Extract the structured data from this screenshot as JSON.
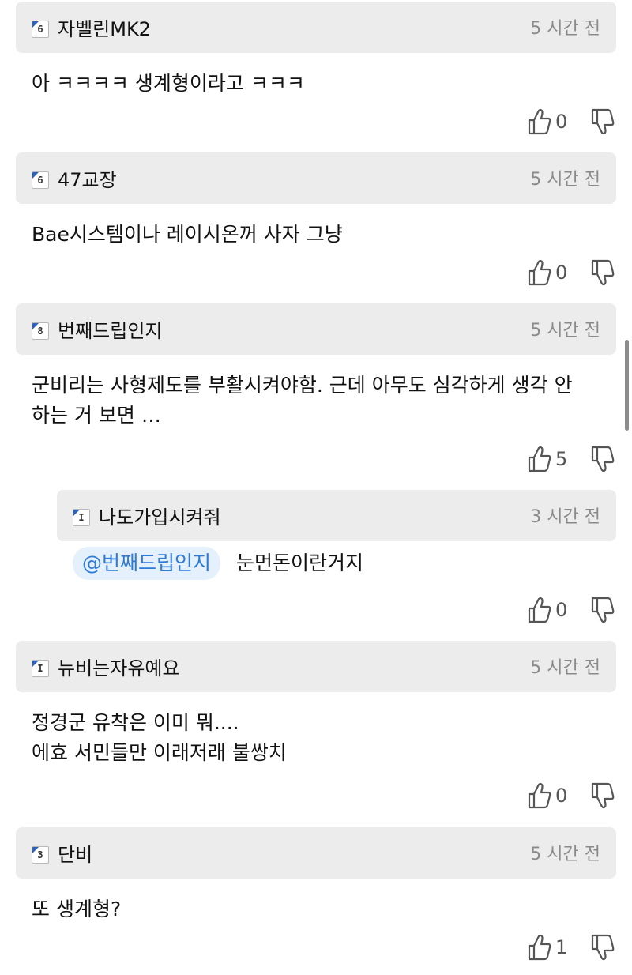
{
  "comments": [
    {
      "level": "6",
      "nickname": "자벨린MK2",
      "time": "5 시간 전",
      "text": "아 ㅋㅋㅋㅋ 생계형이라고 ㅋㅋㅋ",
      "likes": "0",
      "reply": false
    },
    {
      "level": "6",
      "nickname": "47교장",
      "time": "5 시간 전",
      "text": "Bae시스템이나 레이시온꺼 사자 그냥",
      "likes": "0",
      "reply": false
    },
    {
      "level": "8",
      "nickname": "번째드립인지",
      "time": "5 시간 전",
      "text": "군비리는 사형제도를 부활시켜야함. 근데 아무도 심각하게 생각 안\n하는 거 보면 …",
      "likes": "5",
      "reply": false
    },
    {
      "level": "I",
      "nickname": "나도가입시켜줘",
      "time": "3 시간 전",
      "mention": "@번째드립인지",
      "text": "눈먼돈이란거지",
      "likes": "0",
      "reply": true
    },
    {
      "level": "I",
      "nickname": "뉴비는자유예요",
      "time": "5 시간 전",
      "text": "정경군 유착은 이미 뭐....\n에효 서민들만 이래저래 불쌍치",
      "likes": "0",
      "reply": false
    },
    {
      "level": "3",
      "nickname": "단비",
      "time": "5 시간 전",
      "text": "또 생계형?",
      "likes": "1",
      "reply": false
    }
  ],
  "colors": {
    "header_bg": "#ececec",
    "mention_bg": "#e4f0fb",
    "mention_text": "#2f7ad6",
    "badge_accent": "#2b63b8"
  },
  "icons": {
    "like": "thumbs-up-icon",
    "dislike": "thumbs-down-icon",
    "level": "level-badge-icon"
  }
}
